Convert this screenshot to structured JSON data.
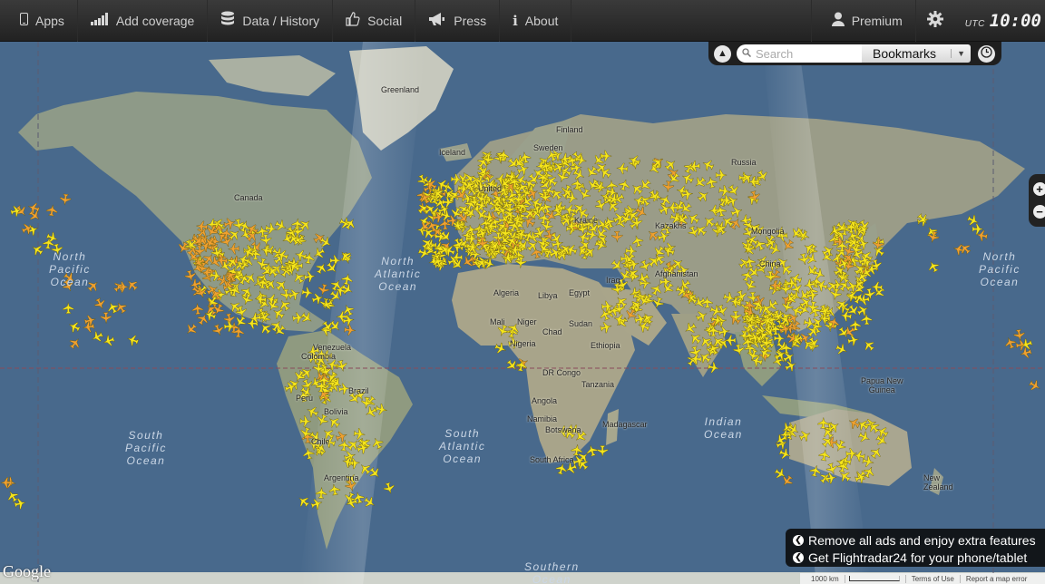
{
  "nav": {
    "items": [
      {
        "label": "Apps",
        "icon": "phone-icon"
      },
      {
        "label": "Add coverage",
        "icon": "signal-bars-icon"
      },
      {
        "label": "Data / History",
        "icon": "database-icon"
      },
      {
        "label": "Social",
        "icon": "thumbs-up-icon"
      },
      {
        "label": "Press",
        "icon": "megaphone-icon"
      },
      {
        "label": "About",
        "icon": "info-icon"
      }
    ],
    "premium_label": "Premium",
    "settings_icon": "gear-icon",
    "clock_zone": "UTC",
    "clock_time": "10:00"
  },
  "search": {
    "placeholder": "Search",
    "bookmarks_label": "Bookmarks"
  },
  "map": {
    "labels": {
      "greenland": "Greenland",
      "finland": "Finland",
      "sweden": "Sweden",
      "iceland": "Iceland",
      "russia": "Russia",
      "united_kingdom": "United",
      "canada": "Canada",
      "ukraine": "Kraine",
      "kazakhstan": "Kazakhs",
      "mongolia": "Mongolia",
      "china": "China",
      "afghanistan": "Afghanistan",
      "iraq": "Iraq",
      "algeria": "Algeria",
      "libya": "Libya",
      "egypt": "Egypt",
      "mali": "Mali",
      "niger": "Niger",
      "sudan": "Sudan",
      "chad": "Chad",
      "nigeria": "Nigeria",
      "ethiopia": "Ethiopia",
      "dr_congo": "DR Congo",
      "tanzania": "Tanzania",
      "angola": "Angola",
      "namibia": "Namibia",
      "botswana": "Botswana",
      "madagascar": "Madagascar",
      "south_africa": "South Africa",
      "venezuela": "Venezuela",
      "colombia": "Colombia",
      "peru": "Peru",
      "brazil": "Brazil",
      "bolivia": "Bolivia",
      "chile": "Chile",
      "argentina": "Argentina",
      "papua_new_guinea": "Papua New\nGuinea",
      "new_zealand": "New\nZealand"
    },
    "oceans": {
      "north_pacific_left": "North\nPacific\nOcean",
      "north_pacific_right": "North\nPacific\nOcean",
      "north_atlantic": "North\nAtlantic\nOcean",
      "south_pacific": "South\nPacific\nOcean",
      "south_atlantic": "South\nAtlantic\nOcean",
      "indian": "Indian\nOcean",
      "southern": "Southern\nOcean"
    },
    "colors": {
      "ocean": "#48698c",
      "land": "#9c9f8e",
      "plane": "#f5e51b",
      "plane_alt": "#f0a030"
    }
  },
  "promo": {
    "line1": "Remove all ads and enjoy extra features",
    "line2": "Get Flightradar24 for your phone/tablet"
  },
  "footer": {
    "google": "Google",
    "scale": "1000 km",
    "terms": "Terms of Use",
    "report": "Report a map error"
  }
}
